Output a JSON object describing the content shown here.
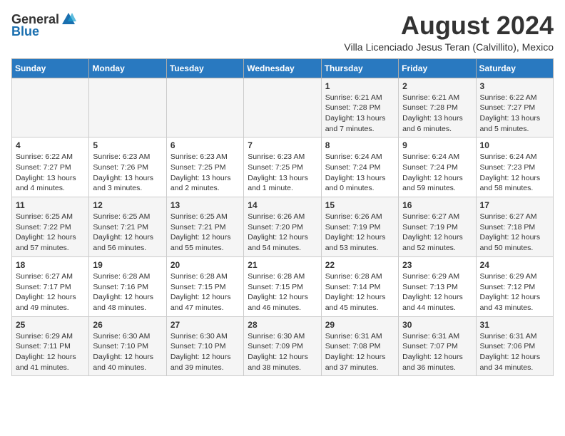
{
  "logo": {
    "general": "General",
    "blue": "Blue"
  },
  "title": "August 2024",
  "location": "Villa Licenciado Jesus Teran (Calvillito), Mexico",
  "days_of_week": [
    "Sunday",
    "Monday",
    "Tuesday",
    "Wednesday",
    "Thursday",
    "Friday",
    "Saturday"
  ],
  "weeks": [
    [
      {
        "day": "",
        "info": ""
      },
      {
        "day": "",
        "info": ""
      },
      {
        "day": "",
        "info": ""
      },
      {
        "day": "",
        "info": ""
      },
      {
        "day": "1",
        "info": "Sunrise: 6:21 AM\nSunset: 7:28 PM\nDaylight: 13 hours and 7 minutes."
      },
      {
        "day": "2",
        "info": "Sunrise: 6:21 AM\nSunset: 7:28 PM\nDaylight: 13 hours and 6 minutes."
      },
      {
        "day": "3",
        "info": "Sunrise: 6:22 AM\nSunset: 7:27 PM\nDaylight: 13 hours and 5 minutes."
      }
    ],
    [
      {
        "day": "4",
        "info": "Sunrise: 6:22 AM\nSunset: 7:27 PM\nDaylight: 13 hours and 4 minutes."
      },
      {
        "day": "5",
        "info": "Sunrise: 6:23 AM\nSunset: 7:26 PM\nDaylight: 13 hours and 3 minutes."
      },
      {
        "day": "6",
        "info": "Sunrise: 6:23 AM\nSunset: 7:25 PM\nDaylight: 13 hours and 2 minutes."
      },
      {
        "day": "7",
        "info": "Sunrise: 6:23 AM\nSunset: 7:25 PM\nDaylight: 13 hours and 1 minute."
      },
      {
        "day": "8",
        "info": "Sunrise: 6:24 AM\nSunset: 7:24 PM\nDaylight: 13 hours and 0 minutes."
      },
      {
        "day": "9",
        "info": "Sunrise: 6:24 AM\nSunset: 7:24 PM\nDaylight: 12 hours and 59 minutes."
      },
      {
        "day": "10",
        "info": "Sunrise: 6:24 AM\nSunset: 7:23 PM\nDaylight: 12 hours and 58 minutes."
      }
    ],
    [
      {
        "day": "11",
        "info": "Sunrise: 6:25 AM\nSunset: 7:22 PM\nDaylight: 12 hours and 57 minutes."
      },
      {
        "day": "12",
        "info": "Sunrise: 6:25 AM\nSunset: 7:21 PM\nDaylight: 12 hours and 56 minutes."
      },
      {
        "day": "13",
        "info": "Sunrise: 6:25 AM\nSunset: 7:21 PM\nDaylight: 12 hours and 55 minutes."
      },
      {
        "day": "14",
        "info": "Sunrise: 6:26 AM\nSunset: 7:20 PM\nDaylight: 12 hours and 54 minutes."
      },
      {
        "day": "15",
        "info": "Sunrise: 6:26 AM\nSunset: 7:19 PM\nDaylight: 12 hours and 53 minutes."
      },
      {
        "day": "16",
        "info": "Sunrise: 6:27 AM\nSunset: 7:19 PM\nDaylight: 12 hours and 52 minutes."
      },
      {
        "day": "17",
        "info": "Sunrise: 6:27 AM\nSunset: 7:18 PM\nDaylight: 12 hours and 50 minutes."
      }
    ],
    [
      {
        "day": "18",
        "info": "Sunrise: 6:27 AM\nSunset: 7:17 PM\nDaylight: 12 hours and 49 minutes."
      },
      {
        "day": "19",
        "info": "Sunrise: 6:28 AM\nSunset: 7:16 PM\nDaylight: 12 hours and 48 minutes."
      },
      {
        "day": "20",
        "info": "Sunrise: 6:28 AM\nSunset: 7:15 PM\nDaylight: 12 hours and 47 minutes."
      },
      {
        "day": "21",
        "info": "Sunrise: 6:28 AM\nSunset: 7:15 PM\nDaylight: 12 hours and 46 minutes."
      },
      {
        "day": "22",
        "info": "Sunrise: 6:28 AM\nSunset: 7:14 PM\nDaylight: 12 hours and 45 minutes."
      },
      {
        "day": "23",
        "info": "Sunrise: 6:29 AM\nSunset: 7:13 PM\nDaylight: 12 hours and 44 minutes."
      },
      {
        "day": "24",
        "info": "Sunrise: 6:29 AM\nSunset: 7:12 PM\nDaylight: 12 hours and 43 minutes."
      }
    ],
    [
      {
        "day": "25",
        "info": "Sunrise: 6:29 AM\nSunset: 7:11 PM\nDaylight: 12 hours and 41 minutes."
      },
      {
        "day": "26",
        "info": "Sunrise: 6:30 AM\nSunset: 7:10 PM\nDaylight: 12 hours and 40 minutes."
      },
      {
        "day": "27",
        "info": "Sunrise: 6:30 AM\nSunset: 7:10 PM\nDaylight: 12 hours and 39 minutes."
      },
      {
        "day": "28",
        "info": "Sunrise: 6:30 AM\nSunset: 7:09 PM\nDaylight: 12 hours and 38 minutes."
      },
      {
        "day": "29",
        "info": "Sunrise: 6:31 AM\nSunset: 7:08 PM\nDaylight: 12 hours and 37 minutes."
      },
      {
        "day": "30",
        "info": "Sunrise: 6:31 AM\nSunset: 7:07 PM\nDaylight: 12 hours and 36 minutes."
      },
      {
        "day": "31",
        "info": "Sunrise: 6:31 AM\nSunset: 7:06 PM\nDaylight: 12 hours and 34 minutes."
      }
    ]
  ]
}
